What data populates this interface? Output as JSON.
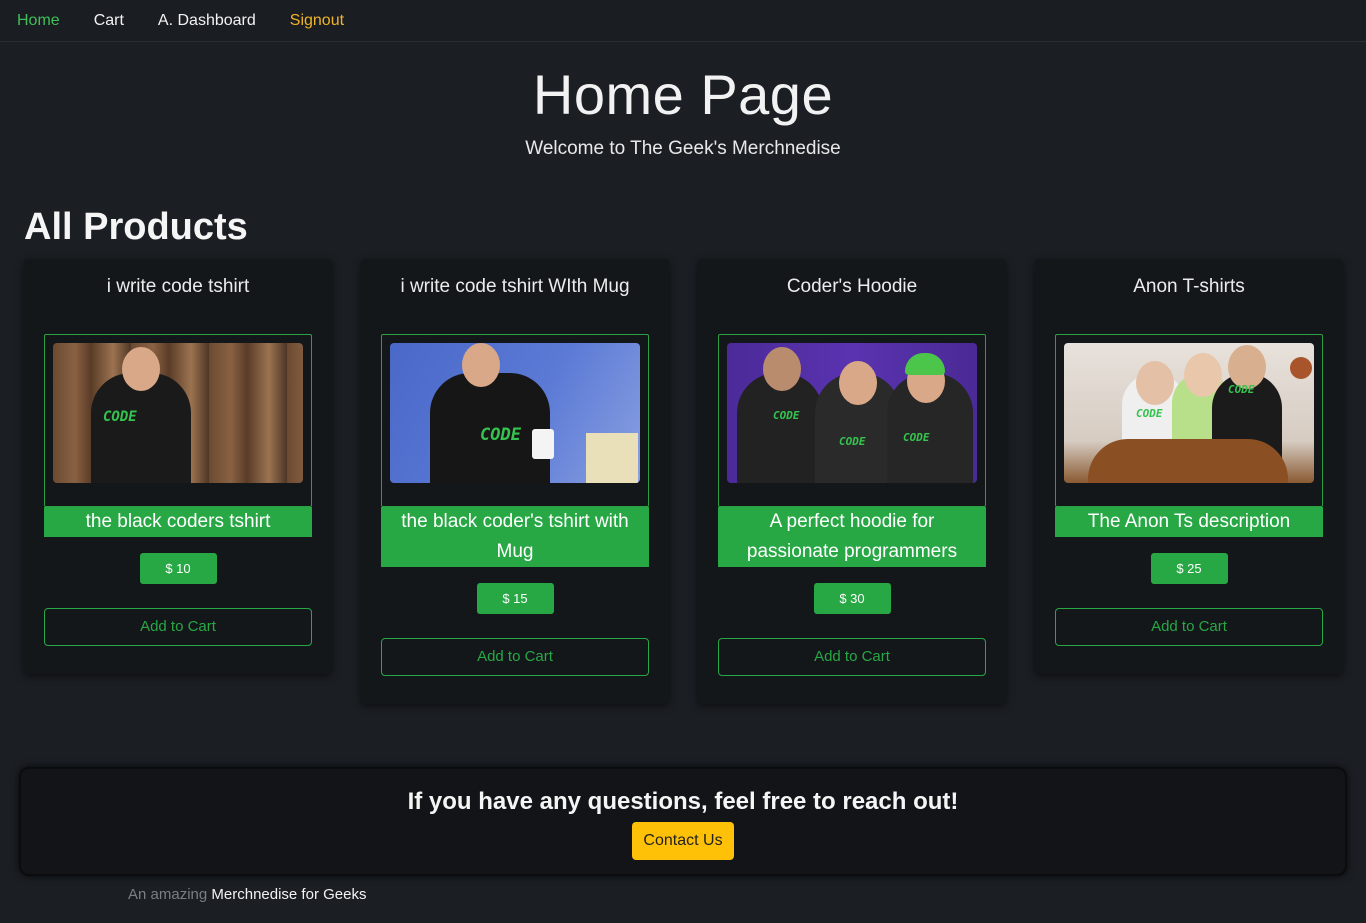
{
  "nav": {
    "home": "Home",
    "cart": "Cart",
    "dashboard": "A. Dashboard",
    "signout": "Signout"
  },
  "hero": {
    "title": "Home Page",
    "subtitle": "Welcome to The Geek's Merchnedise"
  },
  "section_title": "All Products",
  "products": [
    {
      "title": "i write code tshirt",
      "image_icon": "man-in-code-tshirt-photo",
      "description": "the black coders tshirt",
      "price": "$ 10",
      "button": "Add to Cart"
    },
    {
      "title": "i write code tshirt WIth Mug",
      "image_icon": "man-with-code-mug-photo",
      "description": "the black coder's tshirt with Mug",
      "price": "$ 15",
      "button": "Add to Cart"
    },
    {
      "title": "Coder's Hoodie",
      "image_icon": "people-in-code-hoodies-photo",
      "description": "A perfect hoodie for passionate programmers",
      "price": "$ 30",
      "button": "Add to Cart"
    },
    {
      "title": "Anon T-shirts",
      "image_icon": "family-in-code-tshirts-photo",
      "description": "The Anon Ts description",
      "price": "$ 25",
      "button": "Add to Cart"
    }
  ],
  "contact": {
    "text": "If you have any questions, feel free to reach out!",
    "button": "Contact Us"
  },
  "footer": {
    "prefix": "An amazing",
    "brand": "Merchnedise for Geeks"
  },
  "colors": {
    "background": "#1b1f24",
    "card": "#14171a",
    "accent_green": "#28a745",
    "nav_active": "#3fbf5a",
    "signout": "#f0b429",
    "contact_button": "#ffc107"
  }
}
